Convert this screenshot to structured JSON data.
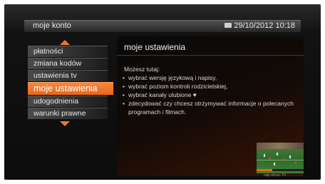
{
  "header": {
    "title": "moje konto",
    "datetime": "29/10/2012 10:18"
  },
  "menu": {
    "items": [
      {
        "label": "płatności"
      },
      {
        "label": "zmiana kodów"
      },
      {
        "label": "ustawienia tv"
      },
      {
        "label": "moje ustawienia",
        "active": true
      },
      {
        "label": "udogodnienia"
      },
      {
        "label": "warunki prawne"
      }
    ]
  },
  "panel": {
    "title": "moje ustawienia",
    "intro": "Możesz tutaj:",
    "bullets": [
      "wybrać wersję językową i napisy,",
      "wybrać poziom kontroli rodzicielskiej,",
      "wybrać kanały ulubione ♥",
      "zdecydować czy chcesz otrzymywać informacje o polecanych programach i filmach."
    ]
  },
  "preview": {
    "caption": "cały ekran: P+"
  },
  "colors": {
    "accent": "#f0782a",
    "active_bg": "#e8661c"
  }
}
